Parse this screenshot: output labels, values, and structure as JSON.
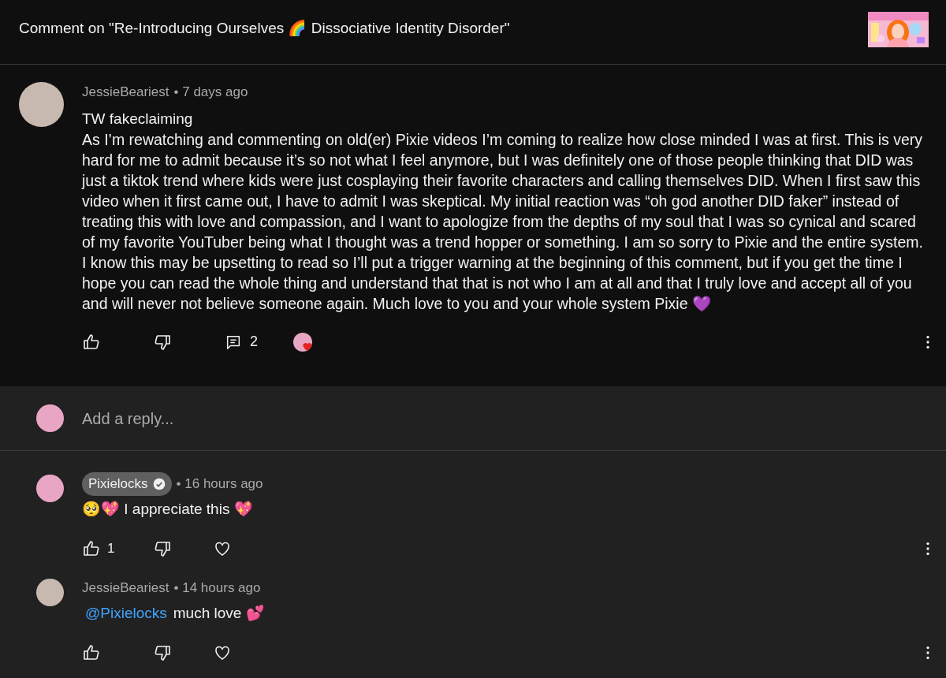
{
  "header": {
    "title": "Comment on \"Re-Introducing Ourselves 🌈 Dissociative Identity Disorder\""
  },
  "comment": {
    "author": "JessieBeariest",
    "time": "• 7 days ago",
    "heading": "TW fakeclaiming",
    "text": "As I’m rewatching and commenting on old(er) Pixie videos I’m coming to realize how close minded I was at first. This is very hard for me to admit because it’s so not what I feel anymore, but I was definitely one of those people thinking that DID was just a tiktok trend where kids were just cosplaying their favorite characters and calling themselves DID. When I first saw this video when it first came out, I have to admit I was skeptical. My initial reaction was “oh god another DID faker” instead of treating this with love and compassion, and I want to apologize from the depths of my soul that I was so cynical and scared of my favorite YouTuber being what I thought was a trend hopper or something. I am so sorry to Pixie and the entire system. I know this may be upsetting to read so I’ll put a trigger warning at the beginning of this comment, but if you get the time I hope you can read the whole thing and understand that that is not who I am at all and that I truly love and accept all of you and will never not believe someone again. Much love to you and your whole system Pixie 💜",
    "reply_count": "2",
    "hearted": true
  },
  "reply_box": {
    "placeholder": "Add a reply..."
  },
  "replies": [
    {
      "author": "Pixielocks",
      "creator": true,
      "time": "• 16 hours ago",
      "text": "🥺💖 I appreciate this 💖",
      "likes": "1",
      "hearted": false
    },
    {
      "author": "JessieBeariest",
      "creator": false,
      "time": "• 14 hours ago",
      "mention": "@Pixielocks",
      "text": "much love 💕",
      "hearted": false
    }
  ]
}
